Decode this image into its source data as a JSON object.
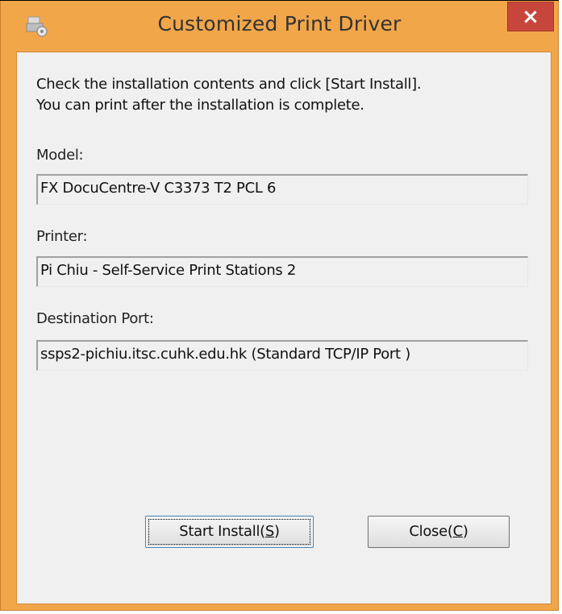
{
  "window": {
    "title": "Customized Print Driver",
    "close_glyph": "×",
    "frame_color": "#f2a64a",
    "close_color": "#c7463c"
  },
  "dialog": {
    "message_line1": "Check the installation contents and click [Start Install].",
    "message_line2": "You can print after the installation is complete.",
    "model_label": "Model:",
    "model_value": "FX DocuCentre-V C3373 T2 PCL 6",
    "printer_label": "Printer:",
    "printer_value": "Pi Chiu - Self-Service Print Stations 2",
    "port_label": "Destination Port:",
    "port_value": "ssps2-pichiu.itsc.cuhk.edu.hk (Standard TCP/IP Port )"
  },
  "buttons": {
    "start_install": {
      "text": "Start Install(",
      "mnemonic": "S",
      "suffix": ")"
    },
    "close": {
      "text": "Close(",
      "mnemonic": "C",
      "suffix": ")"
    }
  }
}
